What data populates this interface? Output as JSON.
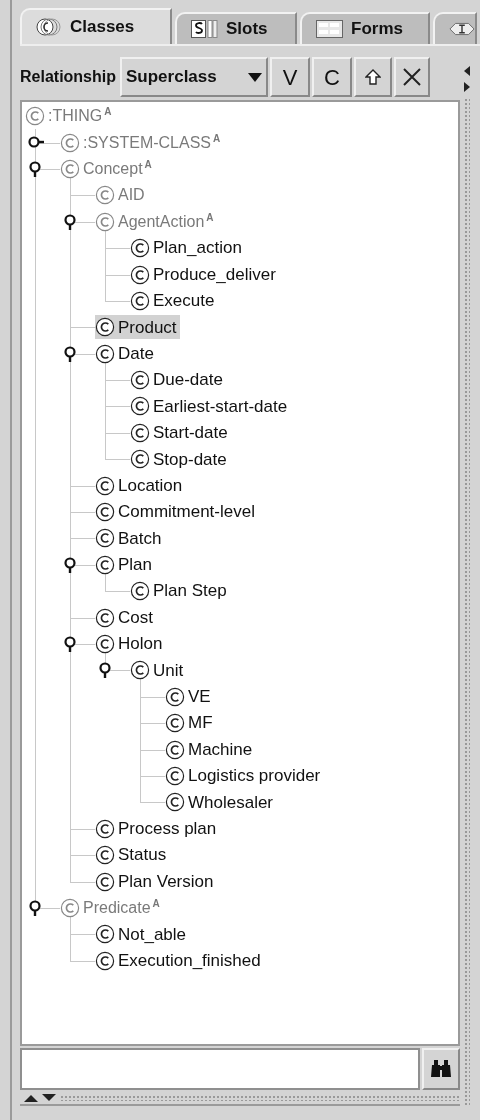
{
  "tabs": [
    {
      "label": "Classes",
      "selected": true
    },
    {
      "label": "Slots",
      "selected": false
    },
    {
      "label": "Forms",
      "selected": false
    },
    {
      "selected": false
    }
  ],
  "toolbar": {
    "label": "Relationship",
    "dropdown": "Superclass",
    "buttons": [
      "V",
      "C"
    ]
  },
  "tree": [
    {
      "label": ":THING",
      "badge": "A",
      "dimmed": true,
      "selected": false,
      "children": [
        {
          "label": ":SYSTEM-CLASS",
          "badge": "A",
          "dimmed": true,
          "selected": false,
          "expanded": false
        },
        {
          "label": "Concept",
          "badge": "A",
          "dimmed": true,
          "selected": false,
          "expanded": true,
          "children": [
            {
              "label": "AID",
              "dimmed": true,
              "selected": false
            },
            {
              "label": "AgentAction",
              "badge": "A",
              "dimmed": true,
              "selected": false,
              "expanded": true,
              "children": [
                {
                  "label": "Plan_action",
                  "dimmed": false,
                  "selected": false
                },
                {
                  "label": "Produce_deliver",
                  "dimmed": false,
                  "selected": false
                },
                {
                  "label": "Execute",
                  "dimmed": false,
                  "selected": false
                }
              ]
            },
            {
              "label": "Product",
              "dimmed": false,
              "selected": true
            },
            {
              "label": "Date",
              "dimmed": false,
              "selected": false,
              "expanded": true,
              "children": [
                {
                  "label": "Due-date",
                  "dimmed": false,
                  "selected": false
                },
                {
                  "label": "Earliest-start-date",
                  "dimmed": false,
                  "selected": false
                },
                {
                  "label": "Start-date",
                  "dimmed": false,
                  "selected": false
                },
                {
                  "label": "Stop-date",
                  "dimmed": false,
                  "selected": false
                }
              ]
            },
            {
              "label": "Location",
              "dimmed": false,
              "selected": false
            },
            {
              "label": "Commitment-level",
              "dimmed": false,
              "selected": false
            },
            {
              "label": "Batch",
              "dimmed": false,
              "selected": false
            },
            {
              "label": "Plan",
              "dimmed": false,
              "selected": false,
              "expanded": true,
              "children": [
                {
                  "label": "Plan Step",
                  "dimmed": false,
                  "selected": false
                }
              ]
            },
            {
              "label": "Cost",
              "dimmed": false,
              "selected": false
            },
            {
              "label": "Holon",
              "dimmed": false,
              "selected": false,
              "expanded": true,
              "children": [
                {
                  "label": "Unit",
                  "dimmed": false,
                  "selected": false,
                  "expanded": true,
                  "children": [
                    {
                      "label": "VE",
                      "dimmed": false,
                      "selected": false
                    },
                    {
                      "label": "MF",
                      "dimmed": false,
                      "selected": false
                    },
                    {
                      "label": "Machine",
                      "dimmed": false,
                      "selected": false
                    },
                    {
                      "label": "Logistics provider",
                      "dimmed": false,
                      "selected": false
                    },
                    {
                      "label": "Wholesaler",
                      "dimmed": false,
                      "selected": false
                    }
                  ]
                }
              ]
            },
            {
              "label": "Process plan",
              "dimmed": false,
              "selected": false
            },
            {
              "label": "Status",
              "dimmed": false,
              "selected": false
            },
            {
              "label": "Plan Version",
              "dimmed": false,
              "selected": false
            }
          ]
        },
        {
          "label": "Predicate",
          "badge": "A",
          "dimmed": true,
          "selected": false,
          "expanded": true,
          "children": [
            {
              "label": "Not_able",
              "dimmed": false,
              "selected": false
            },
            {
              "label": "Execution_finished",
              "dimmed": false,
              "selected": false
            }
          ]
        }
      ]
    }
  ]
}
